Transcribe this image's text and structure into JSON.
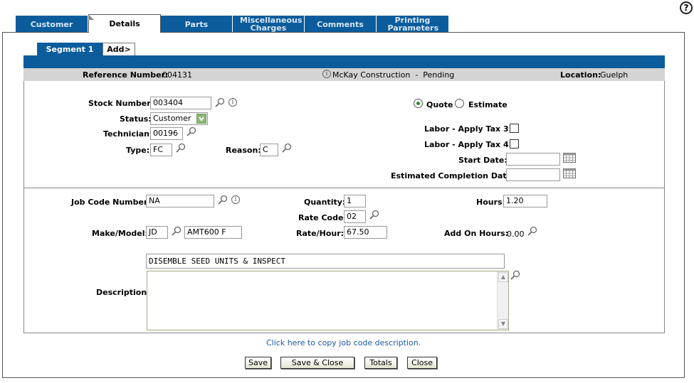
{
  "help_icon": "help-question-icon",
  "tabs": [
    {
      "label": "Customer"
    },
    {
      "label": "Details"
    },
    {
      "label": "Parts"
    },
    {
      "label": "Miscellaneous Charges"
    },
    {
      "label": "Comments"
    },
    {
      "label": "Printing Parameters"
    }
  ],
  "segments": {
    "active": "Segment 1",
    "add": "Add>"
  },
  "header": {
    "reference_label": "Reference Number:",
    "reference_value": "004131",
    "customer_status": "McKay Construction  -  Pending",
    "location_label": "Location:",
    "location_value": "Guelph"
  },
  "top_form": {
    "stock_label": "Stock Number:",
    "stock_value": "003404",
    "status_label": "Status:",
    "status_value": "Customer",
    "technician_label": "Technician:",
    "technician_value": "00196",
    "type_label": "Type:",
    "type_value": "FC",
    "reason_label": "Reason:",
    "reason_value": "C",
    "quote_label": "Quote",
    "estimate_label": "Estimate",
    "tax3_label": "Labor - Apply Tax 3:",
    "tax4_label": "Labor - Apply Tax 4:",
    "start_date_label": "Start Date:",
    "start_date_value": "",
    "completion_label": "Estimated Completion Date:",
    "completion_value": ""
  },
  "job_form": {
    "job_code_label": "Job Code Number:",
    "job_code_value": "NA",
    "quantity_label": "Quantity:",
    "quantity_value": "1",
    "hours_label": "Hours:",
    "hours_value": "1.20",
    "rate_code_label": "Rate Code:",
    "rate_code_value": "02",
    "make_model_label": "Make/Model:",
    "make_value": "JD",
    "model_value": "AMT600 F",
    "rate_hour_label": "Rate/Hour:",
    "rate_hour_value": "67.50",
    "add_on_label": "Add On Hours:",
    "add_on_value": "0.00",
    "description_label": "Description:",
    "description_line": "DISEMBLE SEED UNITS & INSPECT",
    "description_text": ""
  },
  "copy_link": "Click here to copy job code description.",
  "buttons": {
    "save": "Save",
    "save_close": "Save & Close",
    "totals": "Totals",
    "close": "Close"
  },
  "colors": {
    "tab_blue": "#0b5c9c",
    "header_grey": "#d4d4d4",
    "radio_green": "#2a8a2a"
  }
}
